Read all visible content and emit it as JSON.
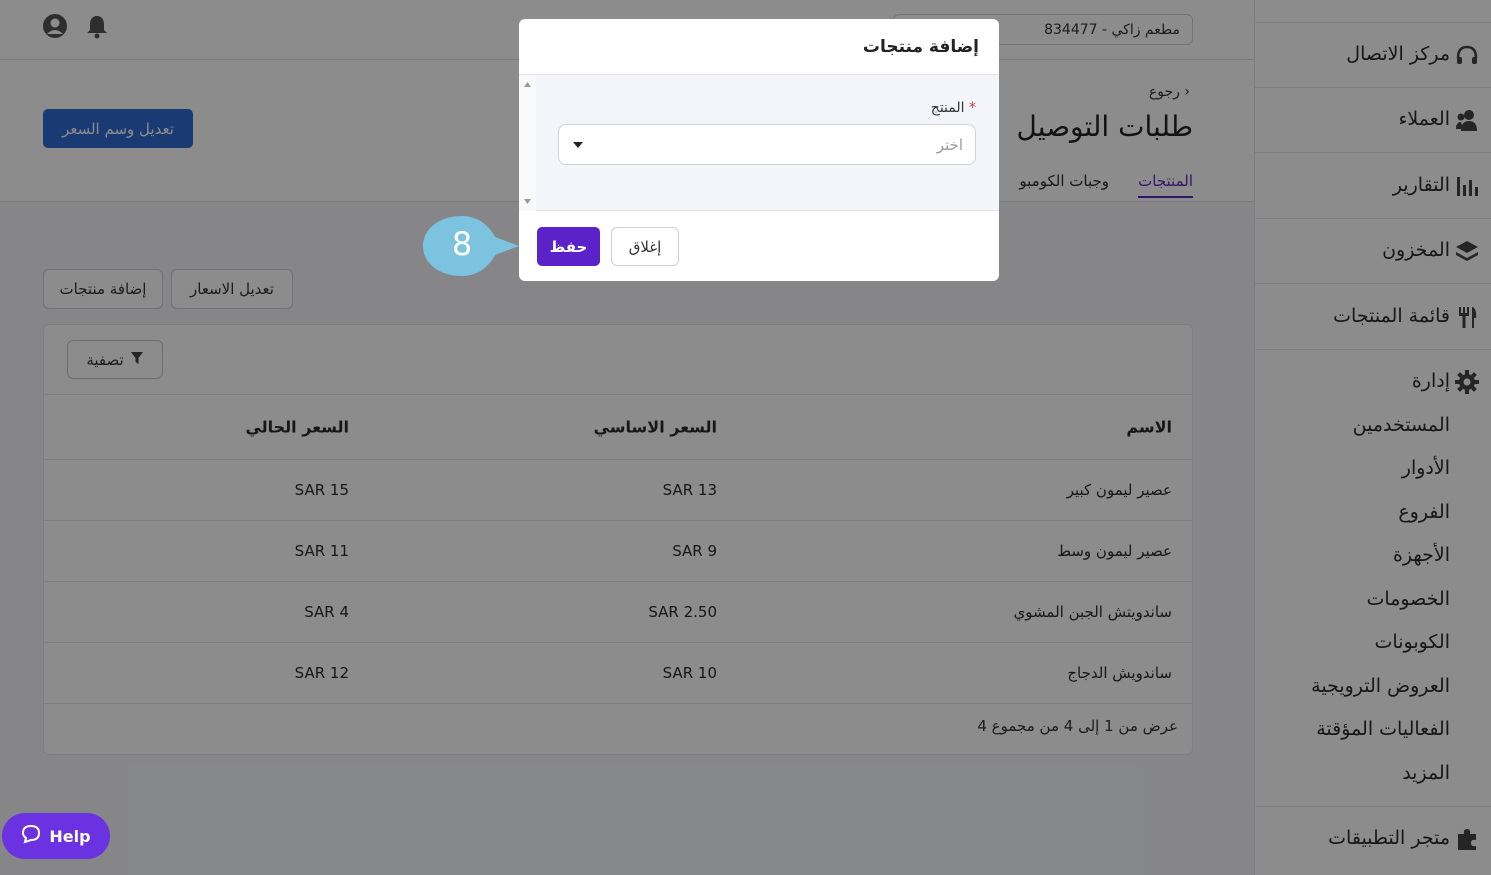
{
  "topbar": {
    "search_text": "مطعم زاكي - 834477",
    "icons": [
      "user-circle-icon",
      "bell-icon",
      "search-icon"
    ]
  },
  "header": {
    "back_label": "رجوع",
    "title": "طلبات التوصيل",
    "tabs": [
      {
        "label": "المنتجات",
        "active": true
      },
      {
        "label": "وجبات الكومبو",
        "active": false
      }
    ],
    "edit_price_tag_button": "تعديل وسم السعر"
  },
  "toolbar": {
    "edit_prices_button": "تعديل الاسعار",
    "add_products_button": "إضافة منتجات"
  },
  "table": {
    "filter_button": "تصفية",
    "columns": [
      "الاسم",
      "السعر الاساسي",
      "السعر الحالي"
    ],
    "rows": [
      {
        "name": "عصير ليمون كبير",
        "base_price": "SAR 13",
        "current_price": "SAR 15"
      },
      {
        "name": "عصير ليمون وسط",
        "base_price": "SAR 9",
        "current_price": "SAR 11"
      },
      {
        "name": "ساندويتش الجبن المشوي",
        "base_price": "SAR 2.50",
        "current_price": "SAR 4"
      },
      {
        "name": "ساندويش الدجاج",
        "base_price": "SAR 10",
        "current_price": "SAR 12"
      }
    ],
    "pagination_text": "عرض من 1 إلى 4 من مجموع 4"
  },
  "sidebar": {
    "items": [
      {
        "label": "مركز الاتصال",
        "icon": "headset-icon"
      },
      {
        "label": "العملاء",
        "icon": "users-icon"
      },
      {
        "label": "التقارير",
        "icon": "bar-chart-icon"
      },
      {
        "label": "المخزون",
        "icon": "layers-icon"
      },
      {
        "label": "قائمة المنتجات",
        "icon": "utensils-icon"
      },
      {
        "label": "إدارة",
        "icon": "gear-icon"
      }
    ],
    "sub_items": [
      "المستخدمين",
      "الأدوار",
      "الفروع",
      "الأجهزة",
      "الخصومات",
      "الكوبونات",
      "العروض الترويجية",
      "الفعاليات المؤقتة",
      "المزيد"
    ],
    "app_store": {
      "label": "متجر التطبيقات",
      "icon": "puzzle-icon"
    }
  },
  "help_button": "Help",
  "modal": {
    "title": "إضافة منتجات",
    "field_label": "المنتج",
    "required_mark": "*",
    "select_placeholder": "اختر",
    "save_button": "حفظ",
    "close_button": "إغلاق"
  },
  "step_marker": "8",
  "colors": {
    "accent_purple": "#5a22c8",
    "primary_blue": "#2f6bd0",
    "marker": "#7cc3e0"
  }
}
